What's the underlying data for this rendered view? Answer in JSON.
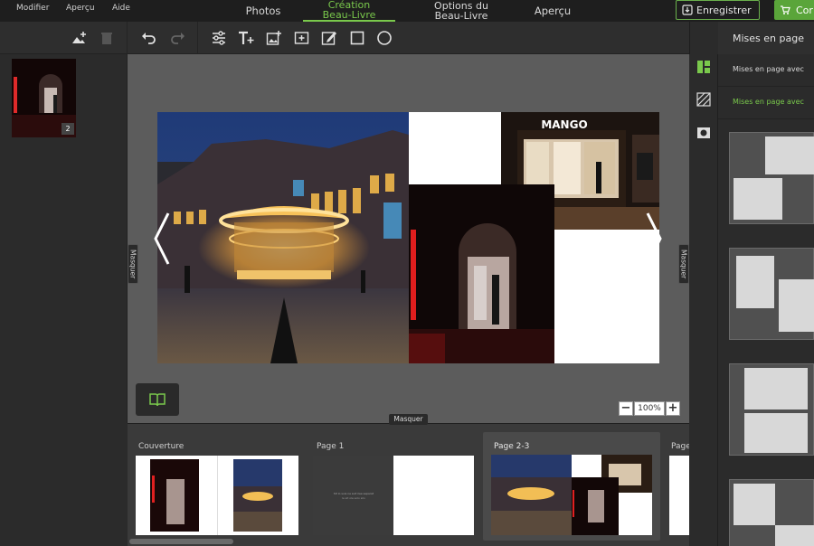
{
  "menu": {
    "modifier": "Modifier",
    "apercu": "Aperçu",
    "aide": "Aide"
  },
  "tabs": {
    "photos": "Photos",
    "creation_l1": "Création",
    "creation_l2": "Beau-Livre",
    "options_l1": "Options du",
    "options_l2": "Beau-Livre",
    "apercu": "Aperçu"
  },
  "actions": {
    "save": "Enregistrer",
    "order": "Cor"
  },
  "left": {
    "thumb_count": "2"
  },
  "canvas": {
    "side_tab": "Masquer",
    "zoom": "100%",
    "zoom_minus": "−",
    "zoom_plus": "+"
  },
  "bottom": {
    "masquer": "Masquer",
    "pages": [
      {
        "label": "Couverture"
      },
      {
        "label": "Page 1"
      },
      {
        "label": "Page 2-3"
      },
      {
        "label": "Page"
      }
    ],
    "page1_text_l1": "Sit lo suis ne suit ilee separat",
    "page1_text_l2": "le sit ole solo silo"
  },
  "right": {
    "title": "Mises en page",
    "options": [
      "Mises en page avec",
      "Mises en page avec"
    ]
  },
  "store_sign": "MANGO",
  "colors": {
    "accent": "#7ac94c",
    "save_border": "#6ab04c",
    "order_bg": "#5aa53a"
  },
  "icons": {
    "add_image": "add-image-icon",
    "trash": "trash-icon",
    "undo": "undo-icon",
    "redo": "redo-icon",
    "settings": "sliders-icon",
    "text": "text-add-icon",
    "image": "image-add-icon",
    "frame": "frame-add-icon",
    "edit_frame": "edit-frame-icon",
    "square": "square-icon",
    "circle": "circle-icon"
  }
}
